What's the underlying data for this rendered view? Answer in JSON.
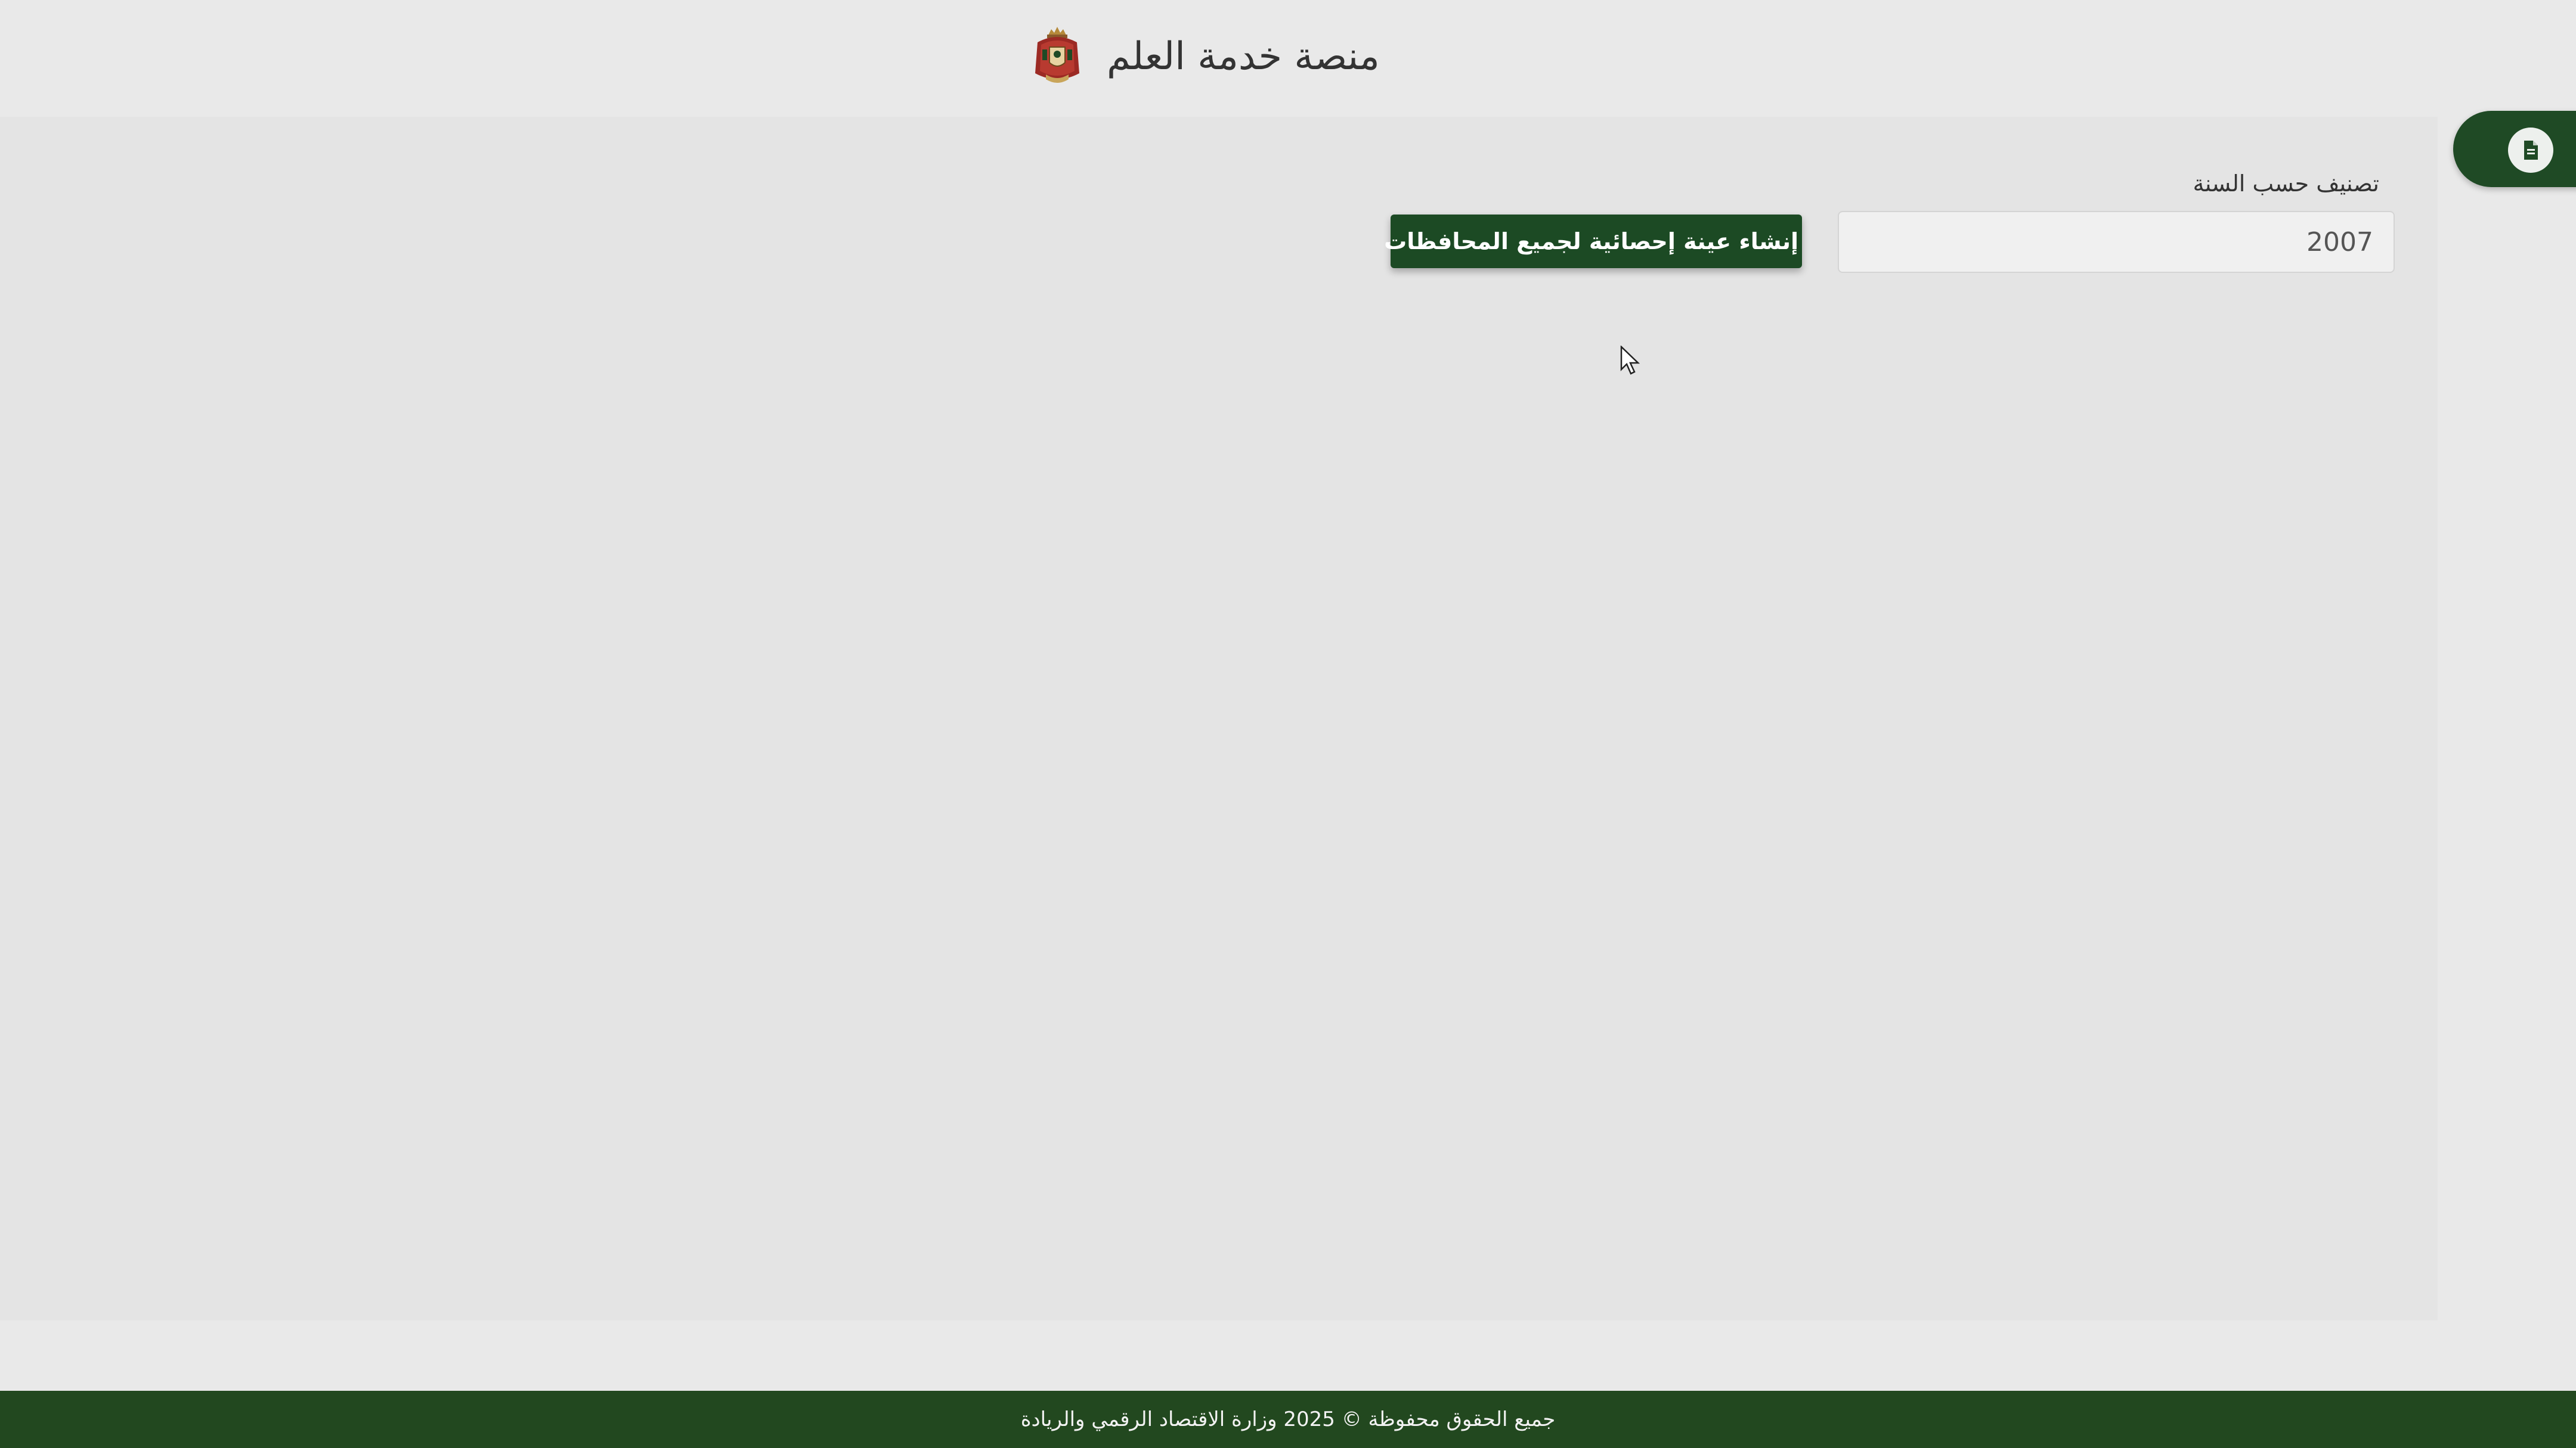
{
  "header": {
    "title": "منصة خدمة العلم",
    "emblem_icon": "jordan-coat-of-arms"
  },
  "side_panel": {
    "icon": "document-icon",
    "color": "#1f4a25"
  },
  "form": {
    "year_label": "تصنيف حسب السنة",
    "year_value": "2007",
    "generate_button_label": "إنشاء عينة إحصائية لجميع المحافظات"
  },
  "footer": {
    "text": "جميع الحقوق محفوظة © 2025 وزارة الاقتصاد الرقمي والريادة",
    "color": "#22481f"
  },
  "colors": {
    "accent": "#1c4a24",
    "background": "#e9e9e9"
  }
}
